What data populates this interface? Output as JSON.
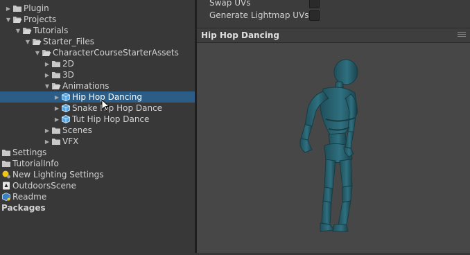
{
  "project_tree": {
    "items": [
      {
        "label": "Plugin",
        "depth": 1,
        "expanded": false,
        "icon": "folder-icon",
        "selected": false
      },
      {
        "label": "Projects",
        "depth": 1,
        "expanded": true,
        "icon": "folder-open-icon",
        "selected": false
      },
      {
        "label": "Tutorials",
        "depth": 2,
        "expanded": true,
        "icon": "folder-open-icon",
        "selected": false
      },
      {
        "label": "Starter_Files",
        "depth": 3,
        "expanded": true,
        "icon": "folder-open-icon",
        "selected": false
      },
      {
        "label": "CharacterCourseStarterAssets",
        "depth": 4,
        "expanded": true,
        "icon": "folder-open-icon",
        "selected": false
      },
      {
        "label": "2D",
        "depth": 5,
        "expanded": false,
        "icon": "folder-icon",
        "selected": false
      },
      {
        "label": "3D",
        "depth": 5,
        "expanded": false,
        "icon": "folder-icon",
        "selected": false
      },
      {
        "label": "Animations",
        "depth": 5,
        "expanded": true,
        "icon": "folder-open-icon",
        "selected": false
      },
      {
        "label": "Hip Hop Dancing",
        "depth": 6,
        "expanded": false,
        "icon": "model-prefab-icon",
        "selected": true
      },
      {
        "label": "Snake Hip Hop Dance",
        "depth": 6,
        "expanded": false,
        "icon": "model-prefab-icon",
        "selected": false
      },
      {
        "label": "Tut Hip Hop Dance",
        "depth": 6,
        "expanded": false,
        "icon": "model-prefab-icon",
        "selected": false
      },
      {
        "label": "Scenes",
        "depth": 5,
        "expanded": false,
        "icon": "folder-icon",
        "selected": false
      },
      {
        "label": "VFX",
        "depth": 5,
        "expanded": false,
        "icon": "folder-icon",
        "selected": false
      },
      {
        "label": "Settings",
        "depth": 0,
        "icon": "folder-icon",
        "selected": false
      },
      {
        "label": "TutorialInfo",
        "depth": 0,
        "icon": "folder-icon",
        "selected": false
      },
      {
        "label": "New Lighting Settings",
        "depth": 0,
        "icon": "lighting-settings-icon",
        "selected": false
      },
      {
        "label": "OutdoorsScene",
        "depth": 0,
        "icon": "scene-icon",
        "selected": false
      },
      {
        "label": "Readme",
        "depth": 0,
        "icon": "readme-icon",
        "selected": false
      },
      {
        "label": "Packages",
        "depth": 0,
        "icon": "",
        "selected": false,
        "bold": true
      }
    ]
  },
  "inspector": {
    "swap_uvs_label": "Swap UVs",
    "swap_uvs_checked": false,
    "generate_lightmap_uvs_label": "Generate Lightmap UVs",
    "generate_lightmap_uvs_checked": false
  },
  "preview": {
    "title": "Hip Hop Dancing",
    "model_icon": "humanoid-model-preview",
    "model_color": "#2e6b78"
  },
  "colors": {
    "panel_bg": "#383838",
    "selection": "#2c5d87",
    "preview_bg": "#474747",
    "folder": "#c8c8c8",
    "prefab": "#4fa3e0"
  }
}
